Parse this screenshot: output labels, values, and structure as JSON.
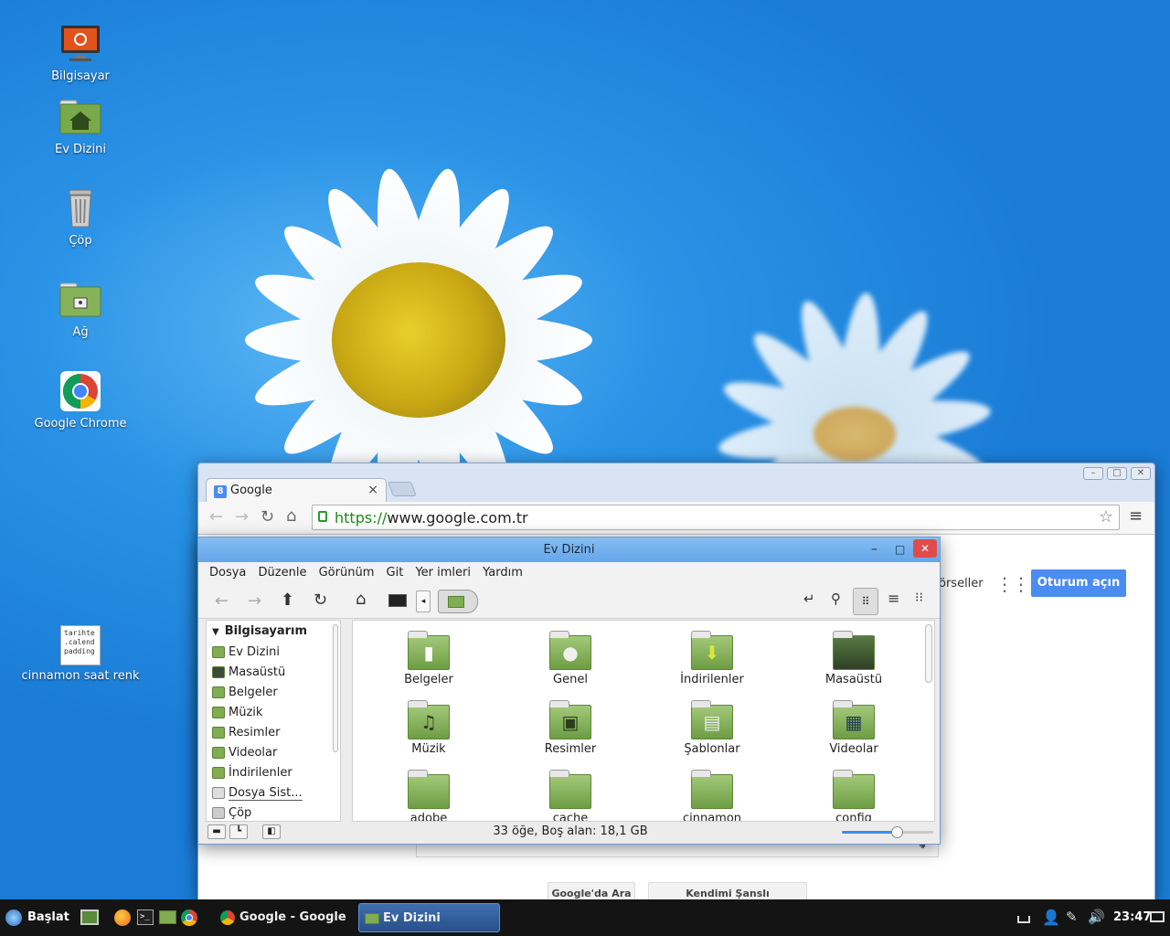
{
  "desktop": {
    "icons": [
      {
        "label": "Bilgisayar",
        "icon": "computer-icon"
      },
      {
        "label": "Ev Dizini",
        "icon": "home-folder-icon"
      },
      {
        "label": "Çöp",
        "icon": "trash-icon"
      },
      {
        "label": "Ağ",
        "icon": "network-folder-icon"
      },
      {
        "label": "Google Chrome",
        "icon": "chrome-icon"
      },
      {
        "label": "cinnamon saat renk",
        "icon": "text-file-icon",
        "preview": [
          "tarihte",
          ".calend",
          "padding"
        ]
      }
    ]
  },
  "chrome": {
    "tab_title": "Google",
    "tab_close": "×",
    "url_scheme": "https://",
    "url_host": "www.google.com.tr",
    "page": {
      "gorseller_fragment": "örseller",
      "signin_label": "Oturum açın",
      "search_button": "Google'da Ara",
      "lucky_button": "Kendimi Şanslı Hissediyorum"
    }
  },
  "nemo": {
    "title": "Ev Dizini",
    "menu": [
      "Dosya",
      "Düzenle",
      "Görünüm",
      "Git",
      "Yer imleri",
      "Yardım"
    ],
    "sidebar": {
      "header": "Bilgisayarım",
      "items": [
        "Ev Dizini",
        "Masaüstü",
        "Belgeler",
        "Müzik",
        "Resimler",
        "Videolar",
        "İndirilenler",
        "Dosya Sist...",
        "Çöp"
      ]
    },
    "files": [
      {
        "name": "Belgeler",
        "glyph": "document-icon"
      },
      {
        "name": "Genel",
        "glyph": "user-icon"
      },
      {
        "name": "İndirilenler",
        "glyph": "download-icon"
      },
      {
        "name": "Masaüstü",
        "glyph": "desktop-icon"
      },
      {
        "name": "Müzik",
        "glyph": "music-icon"
      },
      {
        "name": "Resimler",
        "glyph": "picture-icon"
      },
      {
        "name": "Şablonlar",
        "glyph": "template-icon"
      },
      {
        "name": "Videolar",
        "glyph": "film-icon"
      },
      {
        "name": "adobe",
        "glyph": ""
      },
      {
        "name": "cache",
        "glyph": ""
      },
      {
        "name": "cinnamon",
        "glyph": ""
      },
      {
        "name": "config",
        "glyph": ""
      }
    ],
    "status_text": "33 öğe, Boş alan: 18,1 GB",
    "zoom_level": 0.6
  },
  "taskbar": {
    "start_label": "Başlat",
    "windows": [
      {
        "label": "Google - Google C...",
        "active": false
      },
      {
        "label": "Ev Dizini",
        "active": true
      }
    ],
    "clock": "23:47"
  },
  "colors": {
    "desktop_blue": "#2a93e6",
    "signin_blue": "#4a8cf0",
    "nemo_title": "#6eacee",
    "folder_green": "#7fad50",
    "close_red": "#e04b4b"
  }
}
